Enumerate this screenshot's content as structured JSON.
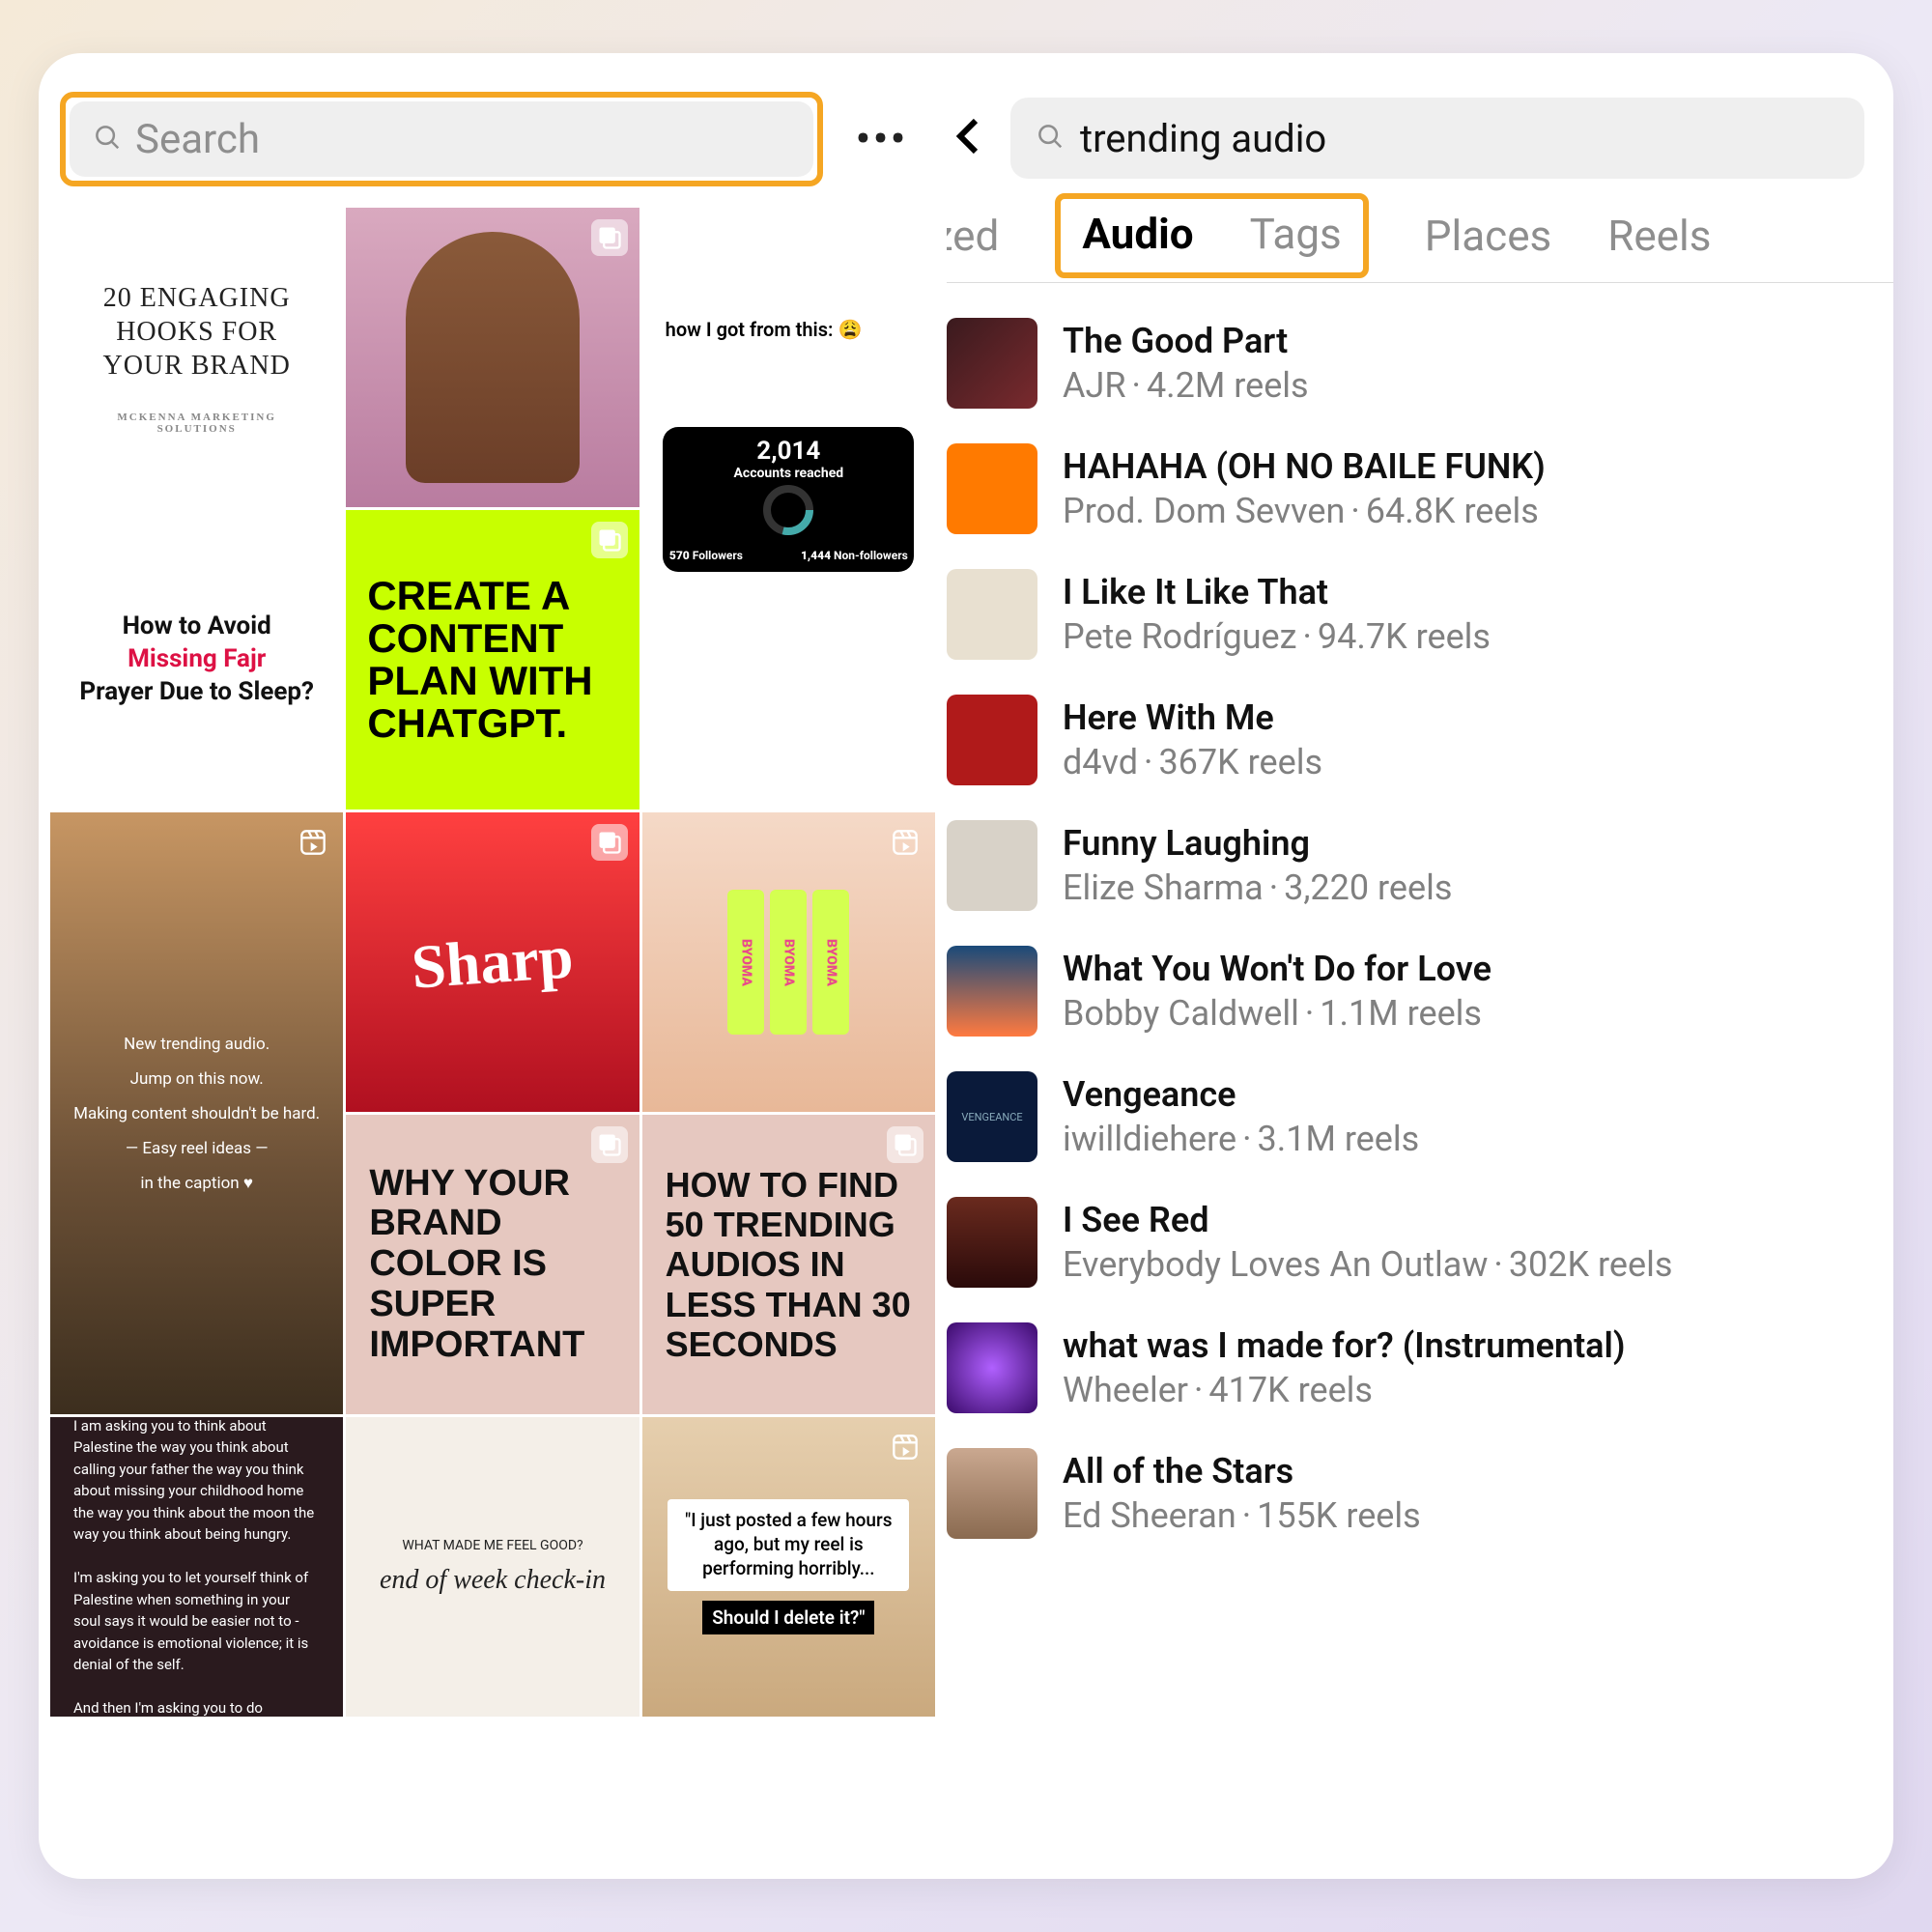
{
  "left": {
    "search_placeholder": "Search",
    "tiles": {
      "t0_title": "20 ENGAGING HOOKS FOR YOUR BRAND",
      "t0_sub": "MCKENNA MARKETING SOLUTIONS",
      "t2_number": "2,014",
      "t2_label": "Accounts reached",
      "t2_left_n": "570",
      "t2_left_l": "Followers",
      "t2_right_n": "1,444",
      "t2_right_l": "Non-followers",
      "t3_l1": "How to Avoid",
      "t3_l2": "Missing Fajr",
      "t3_l3": "Prayer Due to Sleep?",
      "t4": "CREATE A CONTENT PLAN WITH CHATGPT.",
      "t5_cap": "how I got from this: 😩",
      "t6_a": "New trending audio.",
      "t6_b": "Jump on this now.",
      "t6_c": "Making content shouldn't be hard.",
      "t6_d": "— Easy reel ideas —",
      "t6_e": "in the caption ♥",
      "t7": "Sharp",
      "t8": "BYOMA",
      "t9": "WHY YOUR BRAND COLOR IS SUPER IMPORTANT",
      "t10": "HOW TO FIND 50 TRENDING AUDIOS IN LESS THAN 30 SECONDS",
      "t11": "I am not asking you to think about Palestine every second of every minute of every day.\n\nI am asking you to think about Palestine the way you think about calling your father the way you think about missing your childhood home the way you think about the moon the way you think about being hungry.\n\nI'm asking you to let yourself think of Palestine when something in your soul says it would be easier not to - avoidance is emotional violence; it is denial of the self.\n\nAnd then I'm asking you to do something about it. Whatever you know how to do. Even if that is to learn more. Even if that's only to open your mouth.",
      "t12_top": "WHAT MADE ME FEEL GOOD?",
      "t12_big": "end of week check-in",
      "t13_q": "\"I just posted a few hours ago, but my reel is performing horribly...",
      "t13_q2": "Should I delete it?\""
    }
  },
  "right": {
    "search_value": "trending audio",
    "tabs": {
      "partial": "ized",
      "audio": "Audio",
      "tags": "Tags",
      "places": "Places",
      "reels": "Reels"
    },
    "audio": [
      {
        "title": "The Good Part",
        "artist": "AJR",
        "reels": "4.2M reels"
      },
      {
        "title": "HAHAHA (OH NO BAILE FUNK)",
        "artist": "Prod. Dom Sevven",
        "reels": "64.8K reels"
      },
      {
        "title": "I Like It Like That",
        "artist": "Pete Rodríguez",
        "reels": "94.7K reels"
      },
      {
        "title": "Here With Me",
        "artist": "d4vd",
        "reels": "367K reels"
      },
      {
        "title": "Funny Laughing",
        "artist": "Elize Sharma",
        "reels": "3,220 reels"
      },
      {
        "title": "What You Won't Do for Love",
        "artist": "Bobby Caldwell",
        "reels": "1.1M reels"
      },
      {
        "title": "Vengeance",
        "artist": "iwilldiehere",
        "reels": "3.1M reels"
      },
      {
        "title": "I See Red",
        "artist": "Everybody Loves An Outlaw",
        "reels": "302K reels"
      },
      {
        "title": "what was I made for? (Instrumental)",
        "artist": "Wheeler",
        "reels": "417K reels"
      },
      {
        "title": "All of the Stars",
        "artist": "Ed Sheeran",
        "reels": "155K reels"
      }
    ]
  }
}
